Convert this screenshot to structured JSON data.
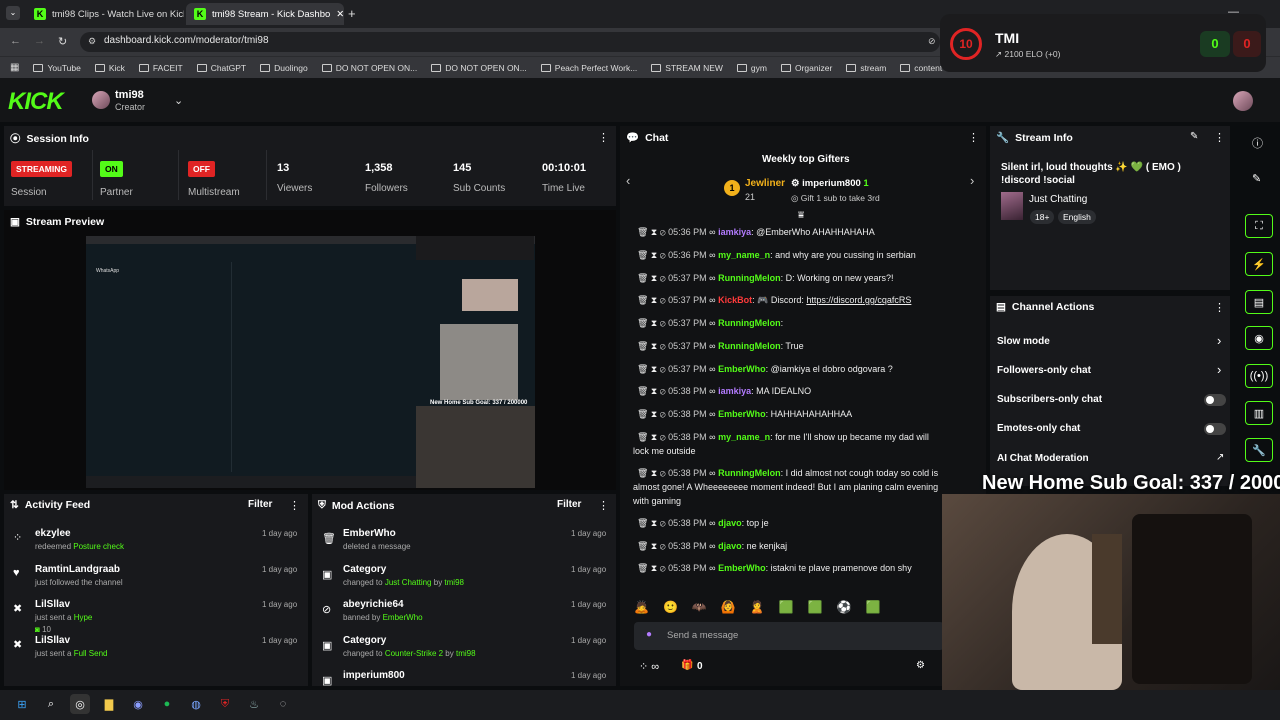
{
  "browser": {
    "tabs": [
      {
        "title": "tmi98 Clips - Watch Live on Kick"
      },
      {
        "title": "tmi98 Stream - Kick Dashbo"
      }
    ],
    "url": "dashboard.kick.com/moderator/tmi98",
    "bookmarks": [
      "YouTube",
      "Kick",
      "FACEIT",
      "ChatGPT",
      "Duolingo",
      "DO NOT OPEN ON...",
      "DO NOT OPEN ON...",
      "Peach Perfect Work...",
      "STREAM NEW",
      "gym",
      "Organizer",
      "stream",
      "content",
      "cs"
    ]
  },
  "header": {
    "logo": "KICK",
    "user": "tmi98",
    "role": "Creator"
  },
  "overlay": {
    "rank": "10",
    "name": "TMI",
    "elo": "2100 ELO (+0)",
    "left_score": "0",
    "right_score": "0",
    "goal": "New Home Sub Goal:  337 / 200000",
    "mini_goal": "New Home Sub Goal: 337 / 200000"
  },
  "session": {
    "title": "Session Info",
    "items": [
      {
        "badge": "STREAMING",
        "label": "Session"
      },
      {
        "badge": "ON",
        "label": "Partner Income"
      },
      {
        "badge": "OFF",
        "label": "Multistream"
      }
    ],
    "stats": [
      {
        "value": "13",
        "label": "Viewers"
      },
      {
        "value": "1,358",
        "label": "Followers"
      },
      {
        "value": "145",
        "label": "Sub Counts"
      },
      {
        "value": "00:10:01",
        "label": "Time Live"
      }
    ]
  },
  "preview": {
    "title": "Stream Preview"
  },
  "activity": {
    "title": "Activity Feed",
    "filter": "Filter",
    "items": [
      {
        "name": "ekzylee",
        "pre": "redeemed ",
        "hl": "Posture check",
        "time": "1 day ago"
      },
      {
        "name": "RamtinLandgraab",
        "pre": "just followed the channel",
        "hl": "",
        "time": "1 day ago"
      },
      {
        "name": "LilSllav",
        "pre": "just sent a ",
        "hl": "Hype",
        "extra": "10",
        "time": "1 day ago"
      },
      {
        "name": "LilSllav",
        "pre": "just sent a ",
        "hl": "Full Send",
        "time": "1 day ago"
      }
    ]
  },
  "mod": {
    "title": "Mod Actions",
    "filter": "Filter",
    "items": [
      {
        "name": "EmberWho",
        "sub": "deleted a message",
        "time": "1 day ago"
      },
      {
        "name": "Category",
        "pre": "changed to ",
        "hl": "Just Chatting",
        "mid": " by ",
        "hl2": "tmi98",
        "time": "1 day ago"
      },
      {
        "name": "abeyrichie64",
        "pre": "banned by ",
        "hl": "EmberWho",
        "mid": "",
        "hl2": "",
        "time": "1 day ago"
      },
      {
        "name": "Category",
        "pre": "changed to ",
        "hl": "Counter-Strike 2",
        "mid": " by ",
        "hl2": "tmi98",
        "time": "1 day ago"
      },
      {
        "name": "imperium800",
        "sub": "",
        "time": "1 day ago"
      }
    ]
  },
  "chat": {
    "title": "Chat",
    "gifters_title": "Weekly top Gifters",
    "gifter1": "Jewliner",
    "gifter1_count": "21",
    "gifter2": "imperium800",
    "gifter2_count": "1",
    "gift_prompt": "Gift 1 sub to take 3rd",
    "placeholder": "Send a message",
    "viewers_count": "0",
    "messages": [
      {
        "time": "05:36 PM",
        "user": "iamkiya",
        "color": "#b37bff",
        "text": "@EmberWho AHAHHAHAHA"
      },
      {
        "time": "05:36 PM",
        "user": "my_name_n",
        "color": "#53fc18",
        "text": "and why are you cussing in serbian"
      },
      {
        "time": "05:37 PM",
        "user": "RunningMelon",
        "color": "#53fc18",
        "text": "D: Working on new years?!"
      },
      {
        "time": "05:37 PM",
        "user": "KickBot",
        "color": "#ff3b3b",
        "text": "🎮 Discord: ",
        "link": "https://discord.gg/cqafcRS"
      },
      {
        "time": "05:37 PM",
        "user": "RunningMelon",
        "color": "#53fc18",
        "text": ""
      },
      {
        "time": "05:37 PM",
        "user": "RunningMelon",
        "color": "#53fc18",
        "text": "True"
      },
      {
        "time": "05:37 PM",
        "user": "EmberWho",
        "color": "#53fc18",
        "text": "@iamkiya el dobro odgovara ?"
      },
      {
        "time": "05:38 PM",
        "user": "iamkiya",
        "color": "#b37bff",
        "text": "MA IDEALNO"
      },
      {
        "time": "05:38 PM",
        "user": "EmberWho",
        "color": "#53fc18",
        "text": "HAHHAHAHAHHAA"
      },
      {
        "time": "05:38 PM",
        "user": "my_name_n",
        "color": "#53fc18",
        "text": "for me I'll show up became my dad will lock me outside"
      },
      {
        "time": "05:38 PM",
        "user": "RunningMelon",
        "color": "#53fc18",
        "text": "I did almost not cough today so cold is almost gone! A Wheeeeeeee moment indeed! But I am planing calm evening with gaming"
      },
      {
        "time": "05:38 PM",
        "user": "djavo",
        "color": "#53fc18",
        "text": "top je"
      },
      {
        "time": "05:38 PM",
        "user": "djavo",
        "color": "#53fc18",
        "text": "ne kenjkaj"
      },
      {
        "time": "05:38 PM",
        "user": "EmberWho",
        "color": "#53fc18",
        "text": "istakni te plave pramenove don shy"
      }
    ]
  },
  "stream_info": {
    "title": "Stream Info",
    "text": "Silent irl, loud thoughts ✨ 💚 ( EMO ) !discord !social",
    "category": "Just Chatting",
    "tag1": "18+",
    "tag2": "English"
  },
  "channel": {
    "title": "Channel Actions",
    "items": [
      "Slow mode",
      "Followers-only chat",
      "Subscribers-only chat",
      "Emotes-only chat",
      "AI Chat Moderation"
    ]
  },
  "colors": {
    "accent": "#53fc18",
    "red": "#e02424"
  }
}
